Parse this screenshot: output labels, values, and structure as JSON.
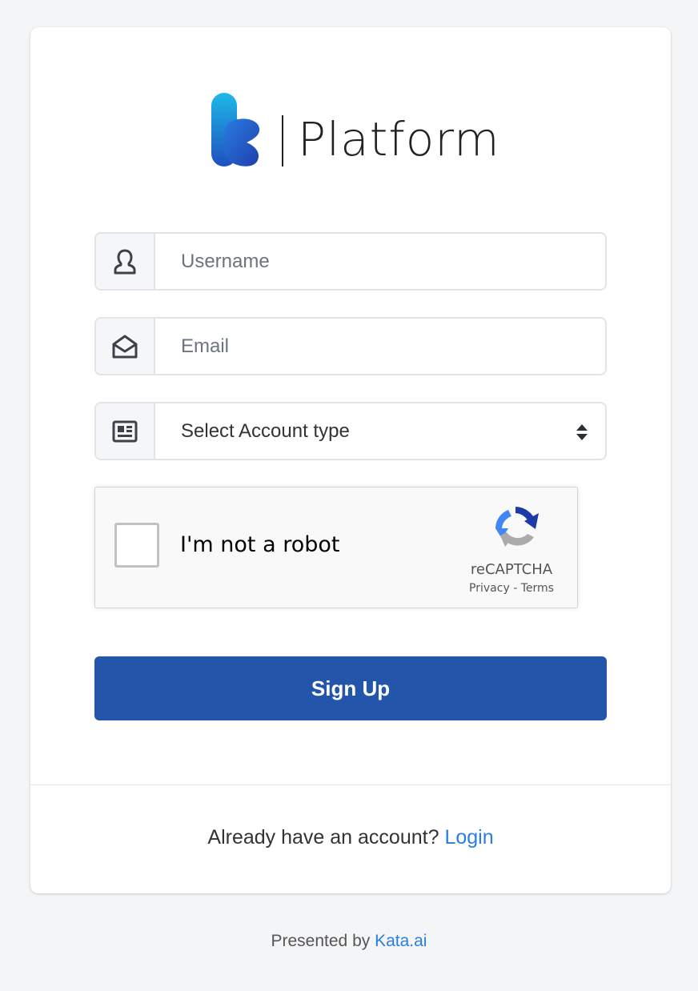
{
  "brand": {
    "product_name": "Platform"
  },
  "form": {
    "username": {
      "placeholder": "Username",
      "value": ""
    },
    "email": {
      "placeholder": "Email",
      "value": ""
    },
    "account_type": {
      "selected": "Select Account type"
    }
  },
  "captcha": {
    "label": "I'm not a robot",
    "brand": "reCAPTCHA",
    "privacy": "Privacy",
    "separator": " - ",
    "terms": "Terms"
  },
  "submit": {
    "label": "Sign Up"
  },
  "login_prompt": {
    "text": "Already have an account? ",
    "link": "Login"
  },
  "footer": {
    "text": "Presented by ",
    "link": "Kata.ai"
  },
  "icons": {
    "username": "user-icon",
    "email": "envelope-open-icon",
    "account_type": "id-card-icon",
    "select": "sort-arrows-icon"
  },
  "colors": {
    "primary_button": "#2356ab",
    "link": "#2a7de1",
    "logo_gradient_start": "#1fb8e8",
    "logo_gradient_end": "#1f4fbf"
  }
}
